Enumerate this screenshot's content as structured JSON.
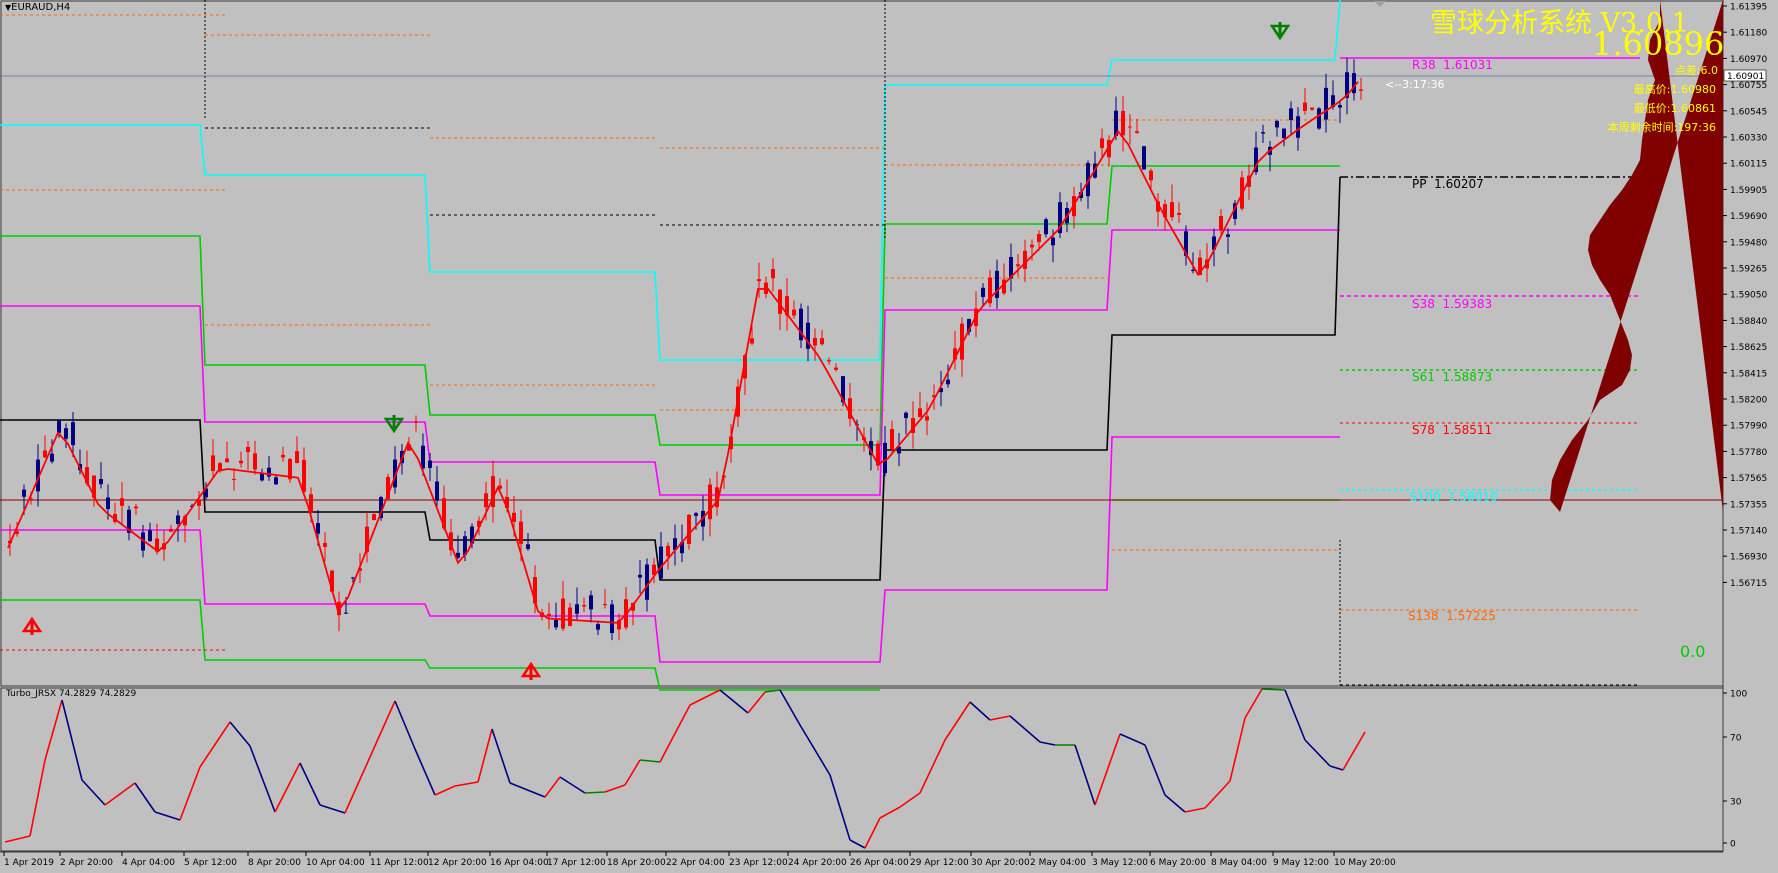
{
  "window": {
    "symbol_title": "EURAUD,H4",
    "dropdown_glyph": "▼"
  },
  "overlay": {
    "brand_title": "雪球分析系统 V3.0.1",
    "big_price": "1.60896",
    "spread": "点差:6.0",
    "high_today": "最高价:1.60980",
    "low_today": "最低价:1.60861",
    "week_remaining": "本周剩余时间:197:36",
    "bar_countdown": "<--3:17:36",
    "zero_value": "0.0"
  },
  "pivot_labels": [
    {
      "name": "R38",
      "value": "1.61031",
      "color": "#ff00ff"
    },
    {
      "name": "PP",
      "value": "1.60207",
      "color": "#000000"
    },
    {
      "name": "S38",
      "value": "1.59383",
      "color": "#ff00ff"
    },
    {
      "name": "S61",
      "value": "1.58873",
      "color": "#00cc00"
    },
    {
      "name": "S78",
      "value": "1.58511",
      "color": "#ff0000"
    },
    {
      "name": "S100",
      "value": "1.58010",
      "color": "#00ffff"
    },
    {
      "name": "S138",
      "value": "1.57225",
      "color": "#ff6600"
    }
  ],
  "price_axis": {
    "ticks": [
      "1.61395",
      "1.61180",
      "1.60970",
      "1.60755",
      "1.60545",
      "1.60330",
      "1.60115",
      "1.59905",
      "1.59690",
      "1.59480",
      "1.59265",
      "1.59050",
      "1.58840",
      "1.58625",
      "1.58415",
      "1.58200",
      "1.57990",
      "1.57780",
      "1.57565",
      "1.57355",
      "1.57140",
      "1.56930",
      "1.56715"
    ],
    "current_price": "1.60901"
  },
  "indicator": {
    "label": "Turbo_JRSX 74.2829 74.2829",
    "ticks": [
      "100",
      "70",
      "30",
      "0"
    ]
  },
  "time_axis": {
    "labels": [
      "1 Apr 2019",
      "2 Apr 20:00",
      "4 Apr 04:00",
      "5 Apr 12:00",
      "8 Apr 20:00",
      "10 Apr 04:00",
      "11 Apr 12:00",
      "12 Apr 20:00",
      "16 Apr 04:00",
      "17 Apr 12:00",
      "18 Apr 20:00",
      "22 Apr 04:00",
      "23 Apr 12:00",
      "24 Apr 20:00",
      "26 Apr 04:00",
      "29 Apr 12:00",
      "30 Apr 20:00",
      "2 May 04:00",
      "3 May 12:00",
      "6 May 20:00",
      "8 May 04:00",
      "9 May 12:00",
      "10 May 20:00"
    ]
  },
  "colors": {
    "background": "#c0c0c0",
    "bull_candle": "#ff0000",
    "bear_candle": "#000080",
    "cyan_line": "#00ffff",
    "magenta_line": "#ff00ff",
    "green_line": "#00cc00",
    "pivot_line": "#000000",
    "volume_profile": "#800000",
    "indicator_up": "#ff0000",
    "indicator_down": "#000080",
    "indicator_flat": "#008000",
    "overlay_text": "#ffff00",
    "arrow_up": "#ff0000",
    "arrow_down": "#008000"
  }
}
